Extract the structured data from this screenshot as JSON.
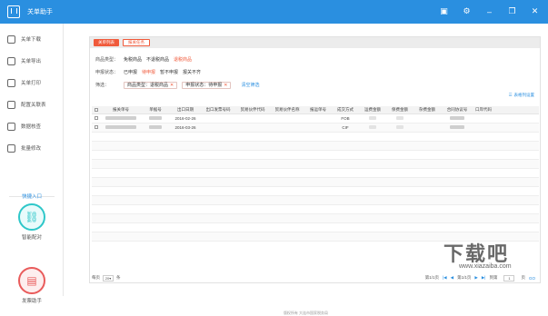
{
  "app": {
    "title": "关单助手"
  },
  "titlebar": {
    "icons": [
      "calendar-icon",
      "gear-icon",
      "minimize-icon",
      "restore-icon",
      "close-icon"
    ]
  },
  "sidebar": {
    "items": [
      {
        "label": "关单下载",
        "icon": "cloud-download-icon"
      },
      {
        "label": "关单导出",
        "icon": "export-icon"
      },
      {
        "label": "关单打印",
        "icon": "printer-icon"
      },
      {
        "label": "配置关联表",
        "icon": "config-icon"
      },
      {
        "label": "数据核查",
        "icon": "check-icon"
      },
      {
        "label": "批量修改",
        "icon": "edit-icon"
      }
    ],
    "quick_title": "快捷入口",
    "quick_buttons": [
      {
        "label": "智能配对",
        "icon": "link-icon"
      },
      {
        "label": "发票助手",
        "icon": "invoice-icon"
      }
    ]
  },
  "tabs": [
    {
      "label": "关单列表",
      "active": true
    },
    {
      "label": "报关任务",
      "active": false
    }
  ],
  "filters": {
    "goods": {
      "label": "商品类型：",
      "options": [
        "免税商品",
        "不退税商品",
        "退税商品"
      ],
      "selected": "退税商品"
    },
    "declare": {
      "label": "申报状态：",
      "options": [
        "已申报",
        "待申报",
        "暂不申报",
        "报关不齐"
      ],
      "selected": "待申报"
    },
    "screening": {
      "label": "筛选：",
      "chips": [
        "商品类型：退税商品",
        "申报状态：待申报"
      ],
      "clear": "清空筛选"
    },
    "set_columns": "表格列设置"
  },
  "table": {
    "columns": [
      "",
      "报关单号",
      "单据号",
      "出口日期",
      "出口发票号码",
      "贸易伙伴代码",
      "贸易伙伴名称",
      "报运单号",
      "成交方式",
      "运费金额",
      "保费金额",
      "杂费金额",
      "合同协议号",
      "口岸代码"
    ],
    "rows": [
      {
        "date": "2016-02-26",
        "trade": "FOB"
      },
      {
        "date": "2016-03-26",
        "trade": "CIF"
      }
    ],
    "empty_rows": 12
  },
  "footer": {
    "per_page_label": "每页",
    "per_page_value": "20",
    "per_page_unit": "条",
    "page_info": "第1/1页",
    "first": "首页",
    "prev": "上一页",
    "page_num": "1",
    "next": "下一页",
    "last": "末页",
    "jump": "到第",
    "jump_unit": "页",
    "go": "GO"
  },
  "copyright": "版权所有 大连市国家税务局",
  "watermark": {
    "main": "下载吧",
    "sub": "www.xiazaiba.com"
  }
}
